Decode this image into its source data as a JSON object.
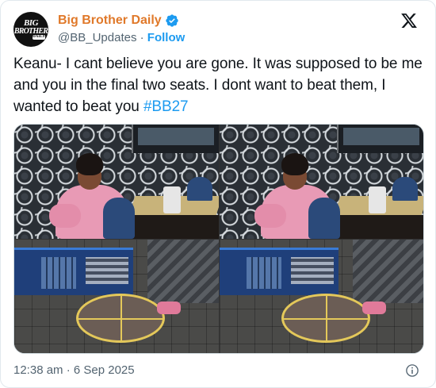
{
  "account": {
    "display_name": "Big Brother Daily",
    "handle": "@BB_Updates",
    "separator": "·",
    "follow_label": "Follow",
    "avatar_text": [
      "BIG",
      "BROTHER",
      "DAILY"
    ]
  },
  "tweet": {
    "text": "Keanu- I cant believe you are gone. It was supposed to be me and you in the final two seats. I dont want to beat them, I wanted to beat you ",
    "hashtag": "#BB27"
  },
  "footer": {
    "timestamp": "12:38 am · 6 Sep 2025"
  },
  "colors": {
    "display_name": "#e0792a",
    "link": "#1d9bf0",
    "verified": "#1d9bf0",
    "muted": "#536471"
  },
  "icons": {
    "verified": "verified-badge-icon",
    "x_logo": "x-logo-icon",
    "info": "info-icon"
  }
}
